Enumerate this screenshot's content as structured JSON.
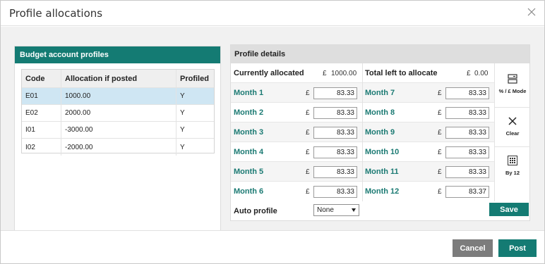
{
  "dialog": {
    "title": "Profile allocations",
    "close_icon": "close-icon"
  },
  "left": {
    "header": "Budget account profiles",
    "columns": [
      "Code",
      "Allocation if posted",
      "Profiled"
    ],
    "rows": [
      {
        "code": "E01",
        "allocation": "1000.00",
        "profiled": "Y",
        "selected": true
      },
      {
        "code": "E02",
        "allocation": "2000.00",
        "profiled": "Y",
        "selected": false
      },
      {
        "code": "I01",
        "allocation": "-3000.00",
        "profiled": "Y",
        "selected": false
      },
      {
        "code": "I02",
        "allocation": "-2000.00",
        "profiled": "Y",
        "selected": false
      }
    ]
  },
  "right": {
    "header": "Profile details",
    "currently_allocated_label": "Currently allocated",
    "currently_allocated_currency": "£",
    "currently_allocated_value": "1000.00",
    "total_left_label": "Total left to allocate",
    "total_left_currency": "£",
    "total_left_value": "0.00",
    "currency_symbol": "£",
    "months_left": [
      {
        "label": "Month 1",
        "value": "83.33"
      },
      {
        "label": "Month 2",
        "value": "83.33"
      },
      {
        "label": "Month 3",
        "value": "83.33"
      },
      {
        "label": "Month 4",
        "value": "83.33"
      },
      {
        "label": "Month 5",
        "value": "83.33"
      },
      {
        "label": "Month 6",
        "value": "83.33"
      }
    ],
    "months_right": [
      {
        "label": "Month 7",
        "value": "83.33"
      },
      {
        "label": "Month 8",
        "value": "83.33"
      },
      {
        "label": "Month 9",
        "value": "83.33"
      },
      {
        "label": "Month 10",
        "value": "83.33"
      },
      {
        "label": "Month 11",
        "value": "83.33"
      },
      {
        "label": "Month 12",
        "value": "83.37"
      }
    ],
    "tools": {
      "mode_label": "% / £ Mode",
      "clear_label": "Clear",
      "by12_label": "By 12"
    },
    "auto_profile_label": "Auto profile",
    "auto_profile_value": "None",
    "save_label": "Save"
  },
  "footer": {
    "cancel_label": "Cancel",
    "post_label": "Post"
  },
  "colors": {
    "accent": "#147b73",
    "selected_row": "#cfe6f3",
    "cancel": "#7c7c7c"
  }
}
